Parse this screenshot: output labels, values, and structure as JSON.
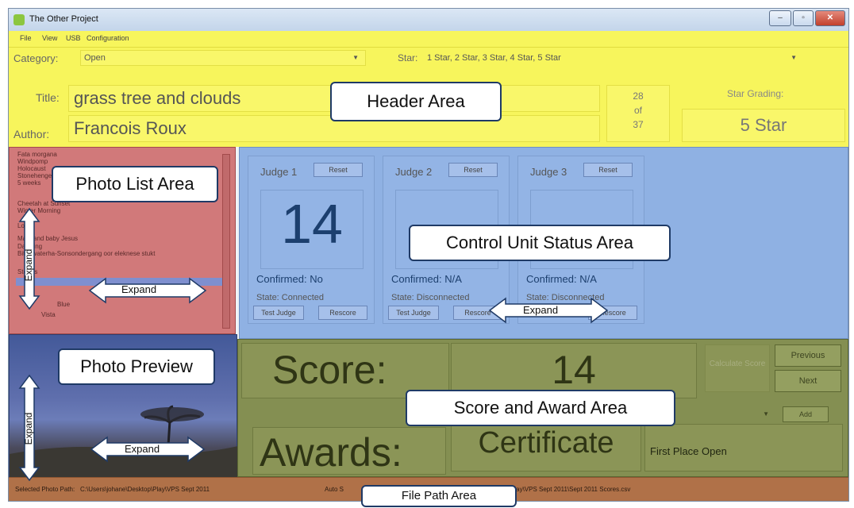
{
  "window": {
    "title": "The Other Project",
    "buttons": {
      "minimize": "–",
      "maximize": "▫",
      "close": "✕"
    }
  },
  "menu": [
    "File",
    "View",
    "USB",
    "Configuration"
  ],
  "category": {
    "label": "Category:",
    "value": "Open"
  },
  "star": {
    "label": "Star:",
    "value": "1 Star, 2 Star, 3 Star, 4 Star, 5 Star"
  },
  "photo": {
    "title_label": "Title:",
    "title": "grass tree and clouds",
    "author_label": "Author:",
    "author": "Francois Roux",
    "position": "28",
    "of": "of",
    "total": "37"
  },
  "star_grading": {
    "label": "Star Grading:",
    "value": "5 Star"
  },
  "photo_list": [
    "Fata morgana",
    "Windpomp",
    "Holocaust",
    "Stonehenge",
    "5 weeks",
    "Cheetah at Sunset",
    "Winter Morning",
    "Lotus",
    "Mary and baby Jesus",
    "Dawning",
    "Bitterwaterha-Sonsondergang oor eleknese stukt",
    "Storms",
    "",
    "Blue",
    "Vista"
  ],
  "judges": [
    {
      "name": "Judge 1",
      "reset": "Reset",
      "score": "14",
      "confirmed": "Confirmed: No",
      "state": "State:  Connected",
      "test": "Test Judge",
      "rescore": "Rescore"
    },
    {
      "name": "Judge 2",
      "reset": "Reset",
      "score": "",
      "confirmed": "Confirmed: N/A",
      "state": "State:  Disconnected",
      "test": "Test Judge",
      "rescore": "Rescore"
    },
    {
      "name": "Judge 3",
      "reset": "Reset",
      "score": "",
      "confirmed": "Confirmed: N/A",
      "state": "State:  Disconnected",
      "test": "",
      "rescore": "Rescore"
    }
  ],
  "score": {
    "label": "Score:",
    "value": "14",
    "calculate": "Calculate Score",
    "previous": "Previous",
    "next": "Next"
  },
  "awards": {
    "label": "Awards:",
    "value": "Certificate",
    "award_text": "First Place Open",
    "add": "Add"
  },
  "status": {
    "selected_label": "Selected Photo Path:",
    "selected_path": "C:\\Users\\johane\\Desktop\\Play\\VPS Sept 2011",
    "auto_label": "Auto S",
    "scores_path": "Play\\VPS Sept 2011\\Sept 2011 Scores.csv"
  },
  "callouts": {
    "header": "Header Area",
    "photo_list": "Photo List Area",
    "control": "Control Unit Status Area",
    "preview": "Photo Preview",
    "score": "Score and Award Area",
    "filepath": "File Path Area",
    "expand": "Expand"
  },
  "colors": {
    "header": "#f7f55c",
    "photo_list": "#d1797a",
    "control": "#8fb1e3",
    "score": "#848f52",
    "status": "#b07148"
  }
}
